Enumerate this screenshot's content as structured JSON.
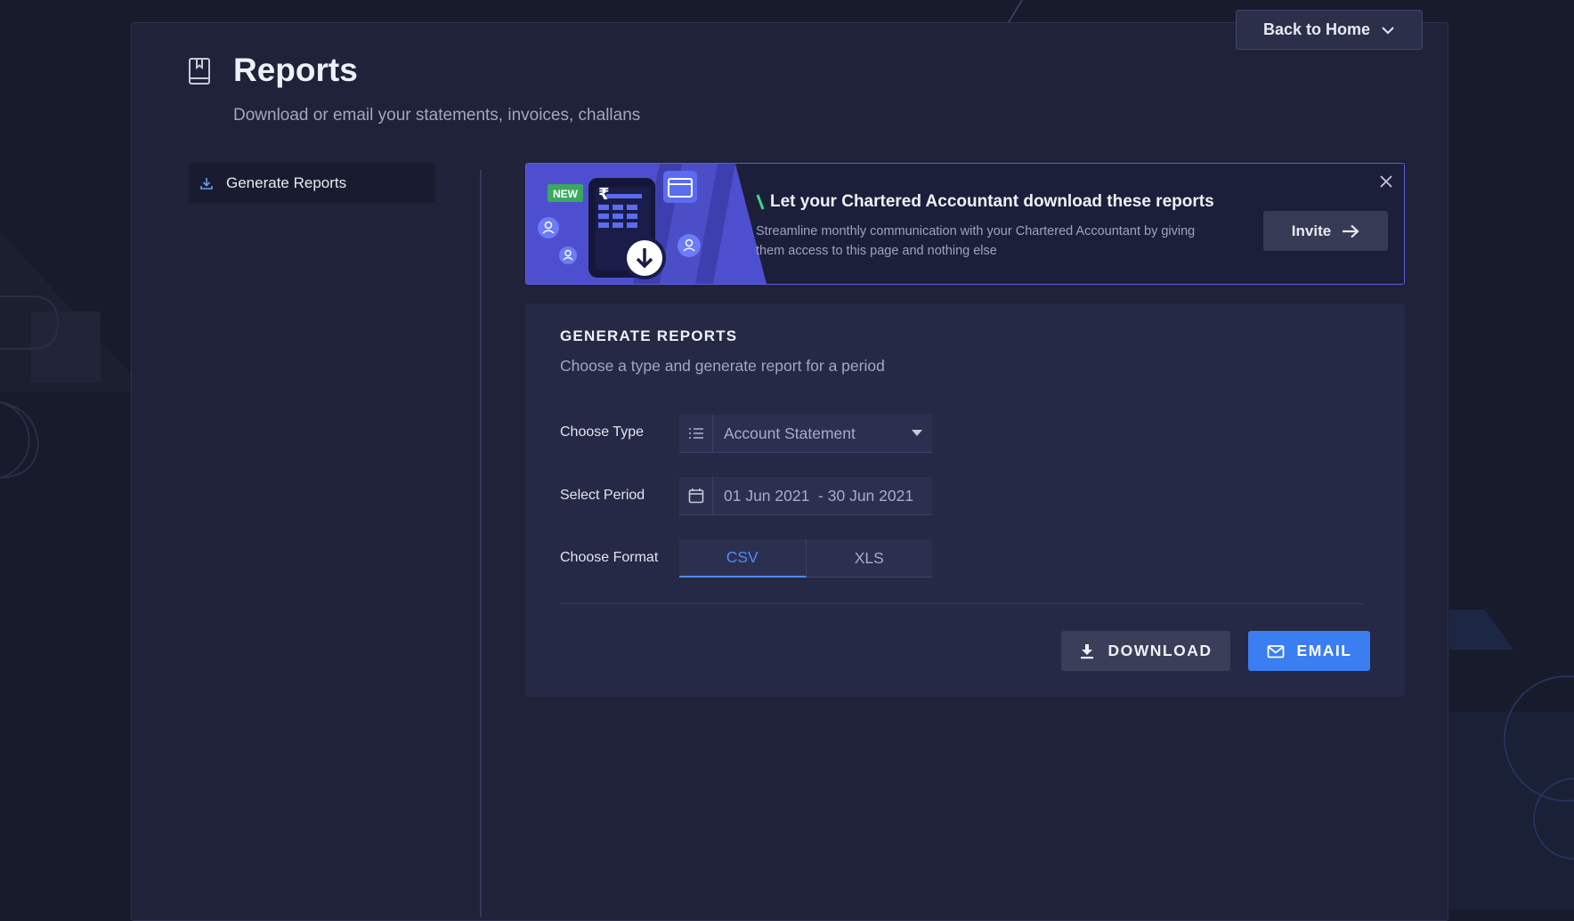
{
  "header": {
    "title": "Reports",
    "subtitle": "Download or email your statements, invoices, challans",
    "back_button": "Back to Home"
  },
  "sidebar": {
    "items": [
      {
        "label": "Generate Reports",
        "icon": "download-icon",
        "active": true
      }
    ]
  },
  "banner": {
    "badge": "NEW",
    "title": "Let your Chartered Accountant download these reports",
    "text": "Streamline monthly communication with your Chartered Accountant by giving them access to this page and nothing else",
    "invite_label": "Invite",
    "accent_color": "#3ddc84"
  },
  "form": {
    "title": "GENERATE REPORTS",
    "subtitle": "Choose a type and generate report for a period",
    "type_label": "Choose Type",
    "type_value": "Account Statement",
    "period_label": "Select Period",
    "period_value": "01 Jun 2021  - 30 Jun 2021",
    "format_label": "Choose Format",
    "format_options": [
      "CSV",
      "XLS"
    ],
    "format_selected": "CSV",
    "download_label": "DOWNLOAD",
    "email_label": "EMAIL"
  },
  "colors": {
    "background": "#181b2b",
    "panel": "#1f2238",
    "card": "#252945",
    "primary": "#3a7ef2",
    "banner_border": "#5b5fd6"
  }
}
